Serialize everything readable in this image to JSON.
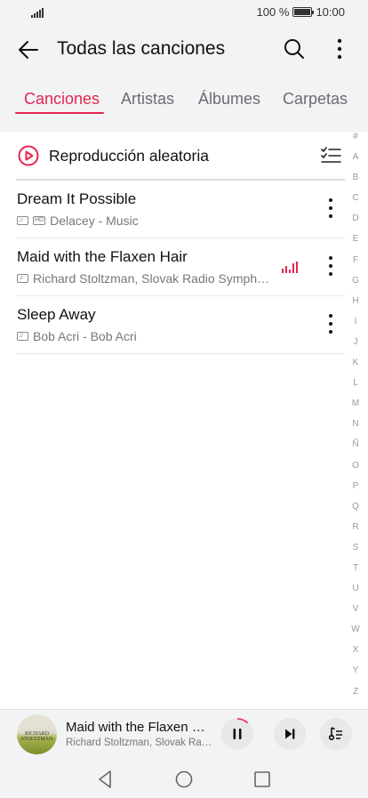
{
  "status_bar": {
    "battery": "100 %",
    "time": "10:00",
    "battery_level": 1.0
  },
  "app_bar": {
    "title": "Todas las canciones",
    "back_icon": "arrow-left-icon",
    "search_icon": "search-icon",
    "more_icon": "more-vertical-icon"
  },
  "tabs": [
    {
      "label": "Canciones",
      "active": true
    },
    {
      "label": "Artistas",
      "active": false
    },
    {
      "label": "Álbumes",
      "active": false
    },
    {
      "label": "Carpetas",
      "active": false
    }
  ],
  "shuffle": {
    "label": "Reproducción aleatoria",
    "icon": "play-circle-icon",
    "multi_select_icon": "checklist-icon"
  },
  "songs": [
    {
      "title": "Dream It Possible",
      "subtitle": "Delacey - Music",
      "hd": true,
      "playing": false
    },
    {
      "title": "Maid with the Flaxen Hair",
      "subtitle": "Richard Stoltzman, Slovak Radio Symph…",
      "hd": false,
      "playing": true
    },
    {
      "title": "Sleep Away",
      "subtitle": "Bob Acri - Bob Acri",
      "hd": false,
      "playing": false
    }
  ],
  "hd_tag": "HD",
  "alphabet_index": [
    "#",
    "A",
    "B",
    "C",
    "D",
    "E",
    "F",
    "G",
    "H",
    "I",
    "J",
    "K",
    "L",
    "M",
    "N",
    "Ñ",
    "O",
    "P",
    "Q",
    "R",
    "S",
    "T",
    "U",
    "V",
    "W",
    "X",
    "Y",
    "Z"
  ],
  "mini_player": {
    "title": "Maid with the Flaxen …",
    "artist": "Richard Stoltzman, Slovak Ra…",
    "album_art_text": [
      "RICHARD",
      "STOLTZMAN"
    ],
    "progress": 0.12,
    "pause_icon": "pause-icon",
    "next_icon": "skip-next-icon",
    "queue_icon": "playlist-icon"
  },
  "colors": {
    "accent": "#e3264f",
    "background": "#f1f3f5",
    "panel": "#ffffff"
  },
  "nav_bar": {
    "back_icon": "nav-back-icon",
    "home_icon": "nav-home-icon",
    "recents_icon": "nav-recents-icon"
  }
}
